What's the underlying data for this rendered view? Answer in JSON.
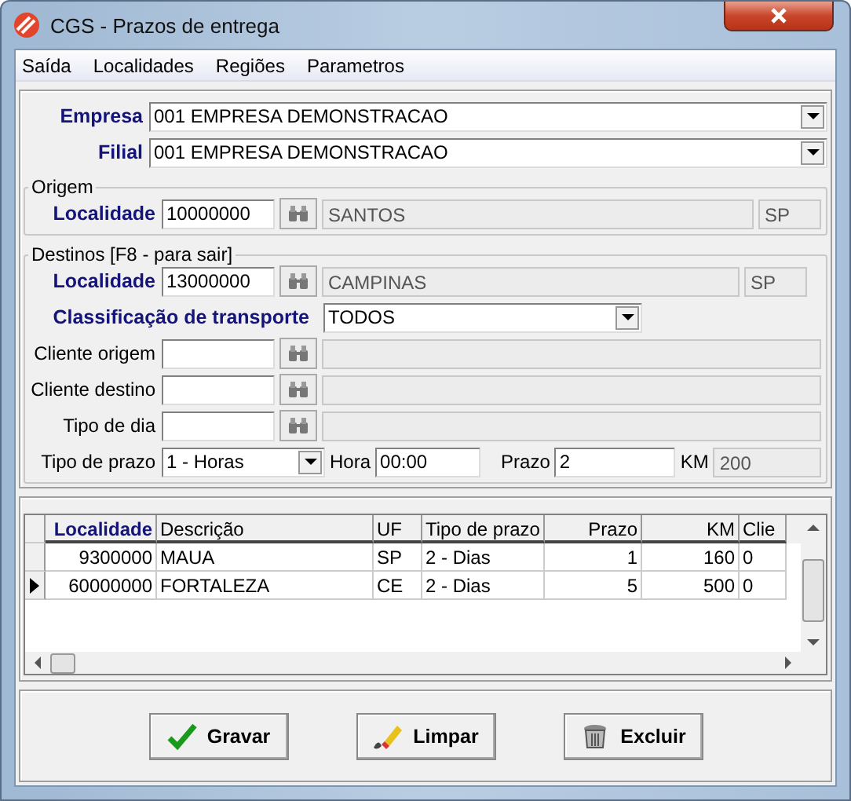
{
  "window": {
    "title": "CGS - Prazos de entrega"
  },
  "menu": [
    "Saída",
    "Localidades",
    "Regiões",
    "Parametros"
  ],
  "empresa": {
    "label": "Empresa",
    "value": "001 EMPRESA DEMONSTRACAO"
  },
  "filial": {
    "label": "Filial",
    "value": "001 EMPRESA DEMONSTRACAO"
  },
  "origem": {
    "legend": "Origem",
    "localidade": {
      "label": "Localidade",
      "code": "10000000",
      "name": "SANTOS",
      "uf": "SP"
    }
  },
  "destinos": {
    "legend": "Destinos  [F8 - para sair]",
    "localidade": {
      "label": "Localidade",
      "code": "13000000",
      "name": "CAMPINAS",
      "uf": "SP"
    },
    "classificacao": {
      "label": "Classificação de transporte",
      "value": "TODOS"
    },
    "lookups": [
      {
        "label": "Cliente origem"
      },
      {
        "label": "Cliente destino"
      },
      {
        "label": "Tipo de dia"
      }
    ],
    "tipo_prazo": {
      "label": "Tipo de prazo",
      "value": "1 - Horas"
    },
    "hora": {
      "label": "Hora",
      "value": "00:00"
    },
    "prazo": {
      "label": "Prazo",
      "value": "2"
    },
    "km": {
      "label": "KM",
      "value": "200"
    }
  },
  "table": {
    "columns": [
      {
        "label": "Localidade",
        "sorted": true
      },
      {
        "label": "Descrição",
        "sorted": false
      },
      {
        "label": "UF",
        "sorted": false
      },
      {
        "label": "Tipo de prazo",
        "sorted": false
      },
      {
        "label": "Prazo",
        "sorted": false
      },
      {
        "label": "KM",
        "sorted": false
      },
      {
        "label": "Clie",
        "sorted": false
      }
    ],
    "rows": [
      {
        "selected": false,
        "cells": [
          "9300000",
          "MAUA",
          "SP",
          "2 - Dias",
          "1",
          "160",
          "0"
        ]
      },
      {
        "selected": true,
        "cells": [
          "60000000",
          "FORTALEZA",
          "CE",
          "2 - Dias",
          "5",
          "500",
          "0"
        ]
      }
    ]
  },
  "buttons": [
    {
      "label": "Gravar",
      "kind": "save"
    },
    {
      "label": "Limpar",
      "kind": "clear"
    },
    {
      "label": "Excluir",
      "kind": "delete"
    }
  ]
}
